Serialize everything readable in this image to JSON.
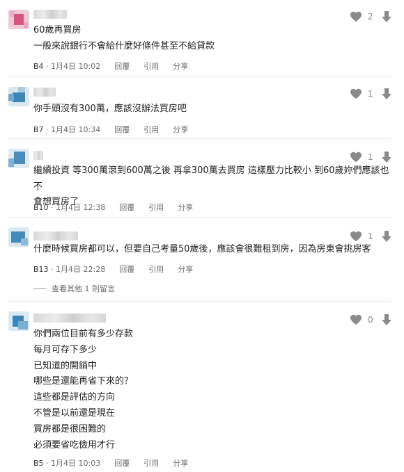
{
  "colors": {
    "heart": "#8a8a8a",
    "divider": "#e6e6e6",
    "text": "#222222",
    "meta": "#6b6b6b"
  },
  "comments": [
    {
      "likes": "2",
      "lines": [
        "60歲再買房",
        "一般來說銀行不會給什麼好條件甚至不給貸款"
      ],
      "floor": "B4",
      "time": "1月4日 10:02",
      "reply_label": "回覆",
      "quote_label": "引用",
      "share_label": "分享"
    },
    {
      "likes": "1",
      "lines": [
        "你手頭沒有300萬，應該沒辦法買房吧"
      ],
      "floor": "B7",
      "time": "1月4日 10:34",
      "reply_label": "回覆",
      "quote_label": "引用",
      "share_label": "分享"
    },
    {
      "likes": "1",
      "lines": [
        "繼續投資 等300萬滾到600萬之後 再拿300萬去買房 這樣壓力比較小 到60歲妳們應該也不",
        "會想買房了"
      ],
      "floor": "B10",
      "time": "1月4日 12:38",
      "reply_label": "回覆",
      "quote_label": "引用",
      "share_label": "分享"
    },
    {
      "likes": "1",
      "lines": [
        "什麼時候買房都可以，但要自己考量50歲後，應該會很難租到房，因為房東會挑房客"
      ],
      "floor": "B13",
      "time": "1月4日 22:28",
      "reply_label": "回覆",
      "quote_label": "引用",
      "share_label": "分享",
      "more_replies": "查看其他 1 則留言"
    },
    {
      "likes": "0",
      "lines": [
        "你們兩位目前有多少存款",
        "每月可存下多少",
        "已知道的開銷中",
        "哪些是還能再省下來的？",
        "這些都是評估的方向",
        "不管是以前還是現在",
        "買房都是很困難的",
        "必須要省吃儉用才行"
      ],
      "floor": "B5",
      "time": "1月4日 10:03",
      "reply_label": "回覆",
      "quote_label": "引用",
      "share_label": "分享"
    }
  ]
}
